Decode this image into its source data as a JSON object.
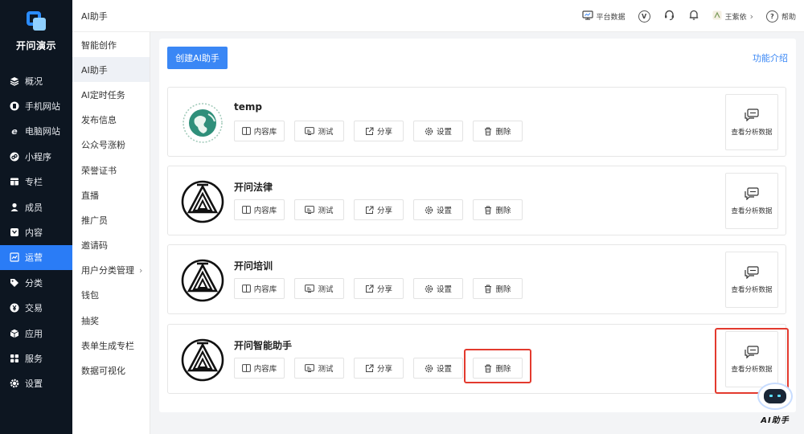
{
  "sidebar": {
    "brand": "开问演示",
    "items": [
      {
        "label": "概况",
        "icon": "layers-icon"
      },
      {
        "label": "手机网站",
        "icon": "mobile-icon"
      },
      {
        "label": "电脑网站",
        "icon": "browser-icon"
      },
      {
        "label": "小程序",
        "icon": "miniprogram-icon"
      },
      {
        "label": "专栏",
        "icon": "column-icon"
      },
      {
        "label": "成员",
        "icon": "user-icon"
      },
      {
        "label": "内容",
        "icon": "content-icon"
      },
      {
        "label": "运营",
        "icon": "chart-icon",
        "active": true
      },
      {
        "label": "分类",
        "icon": "tag-icon"
      },
      {
        "label": "交易",
        "icon": "yen-icon"
      },
      {
        "label": "应用",
        "icon": "cube-icon"
      },
      {
        "label": "服务",
        "icon": "grid-icon"
      },
      {
        "label": "设置",
        "icon": "gear-icon"
      }
    ]
  },
  "submenu": {
    "items": [
      "智能创作",
      "AI助手",
      "AI定时任务",
      "发布信息",
      "公众号涨粉",
      "荣誉证书",
      "直播",
      "推广员",
      "邀请码",
      "用户分类管理",
      "钱包",
      "抽奖",
      "表单生成专栏",
      "数据可视化"
    ],
    "active": "AI助手",
    "expand_arrow": "›"
  },
  "header": {
    "title": "AI助手",
    "platform_data": "平台数据",
    "v_badge": "V",
    "user_name": "王紫依",
    "user_arrow": "›",
    "help": "帮助"
  },
  "panel": {
    "create_button": "创建AI助手",
    "intro_link": "功能介绍",
    "action_labels": {
      "library": "内容库",
      "test": "测试",
      "share": "分享",
      "settings": "设置",
      "delete": "删除"
    },
    "analysis_label": "查看分析数据",
    "assistants": [
      {
        "name": "temp",
        "avatar": "globe"
      },
      {
        "name": "开问法律",
        "avatar": "logo"
      },
      {
        "name": "开问培训",
        "avatar": "logo"
      },
      {
        "name": "开问智能助手",
        "avatar": "logo"
      }
    ]
  },
  "floating": {
    "label": "AI助手"
  },
  "colors": {
    "sidebar_bg": "#0d1621",
    "accent": "#2a7cf6",
    "highlight": "#e33a2e"
  }
}
